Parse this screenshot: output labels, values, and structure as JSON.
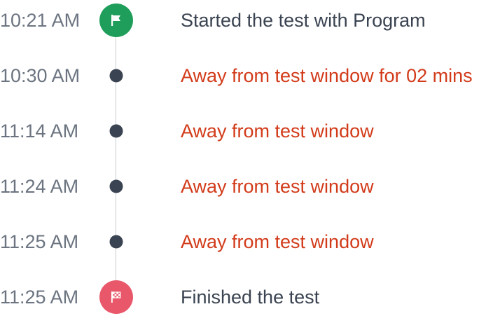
{
  "colors": {
    "time": "#6b7480",
    "normal_text": "#3a4351",
    "alert_text": "#d23b1a",
    "start_badge": "#1e9e5a",
    "finish_badge": "#e8586a",
    "dot": "#3a4351",
    "connector": "#c9cdd2"
  },
  "events": [
    {
      "time": "10:21 AM",
      "text": "Started the test with Program",
      "kind": "start",
      "icon": "flag-icon"
    },
    {
      "time": "10:30 AM",
      "text": "Away from test window for 02 mins",
      "kind": "alert",
      "icon": "dot"
    },
    {
      "time": "11:14 AM",
      "text": "Away from test window",
      "kind": "alert",
      "icon": "dot"
    },
    {
      "time": "11:24 AM",
      "text": "Away from test window",
      "kind": "alert",
      "icon": "dot"
    },
    {
      "time": "11:25 AM",
      "text": "Away from test window",
      "kind": "alert",
      "icon": "dot"
    },
    {
      "time": "11:25 AM",
      "text": "Finished the test",
      "kind": "finish",
      "icon": "checkered-flag-icon"
    }
  ]
}
